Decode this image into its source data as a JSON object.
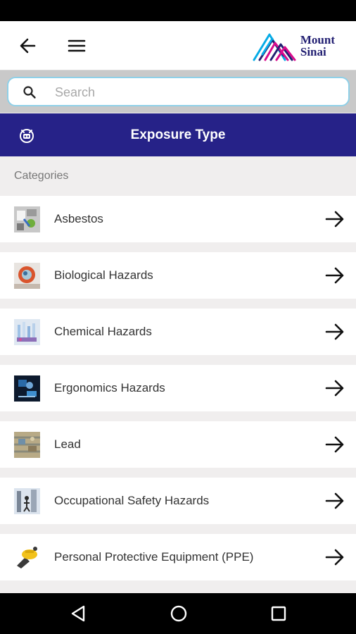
{
  "app_bar": {
    "back_icon": "arrow-left-icon",
    "menu_icon": "hamburger-menu-icon",
    "logo_line1": "Mount",
    "logo_line2": "Sinai"
  },
  "search": {
    "placeholder": "Search",
    "value": "",
    "icon": "search-icon"
  },
  "header": {
    "icon": "exposure-type-icon",
    "title": "Exposure Type"
  },
  "categories_label": "Categories",
  "items": [
    {
      "label": "Asbestos",
      "thumb": "asbestos-thumbnail"
    },
    {
      "label": "Biological Hazards",
      "thumb": "biological-hazards-thumbnail"
    },
    {
      "label": "Chemical Hazards",
      "thumb": "chemical-hazards-thumbnail"
    },
    {
      "label": "Ergonomics Hazards",
      "thumb": "ergonomics-hazards-thumbnail"
    },
    {
      "label": "Lead",
      "thumb": "lead-thumbnail"
    },
    {
      "label": "Occupational Safety Hazards",
      "thumb": "occupational-safety-thumbnail"
    },
    {
      "label": "Personal Protective Equipment (PPE)",
      "thumb": "ppe-thumbnail"
    }
  ],
  "colors": {
    "header_bg": "#262288",
    "brand_navy": "#221f72",
    "search_border": "#8fd0e8"
  },
  "nav": {
    "back": "triangle-back-icon",
    "home": "circle-home-icon",
    "recents": "square-recents-icon"
  }
}
